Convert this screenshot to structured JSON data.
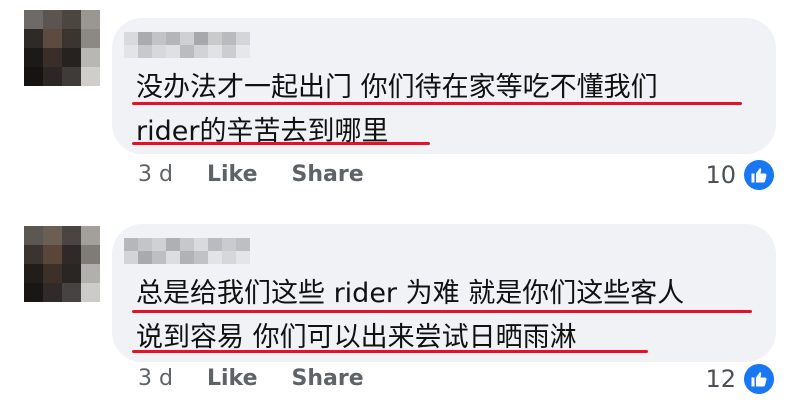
{
  "comments": [
    {
      "text_lines": [
        "没办法才一起出门 你们待在家等吃不懂我们",
        "rider的辛苦去到哪里"
      ],
      "time": "3 d",
      "like_label": "Like",
      "share_label": "Share",
      "reaction_count": "10"
    },
    {
      "text_lines": [
        "总是给我们这些 rider 为难 就是你们这些客人",
        "说到容易 你们可以出来尝试日晒雨淋"
      ],
      "time": "3 d",
      "like_label": "Like",
      "share_label": "Share",
      "reaction_count": "12"
    }
  ],
  "colors": {
    "bubble": "#f0f2f5",
    "underline": "#e8121e",
    "like_blue": "#1877f2",
    "meta_gray": "#5f6368"
  },
  "icons": {
    "reaction": "thumbs-up-icon"
  }
}
